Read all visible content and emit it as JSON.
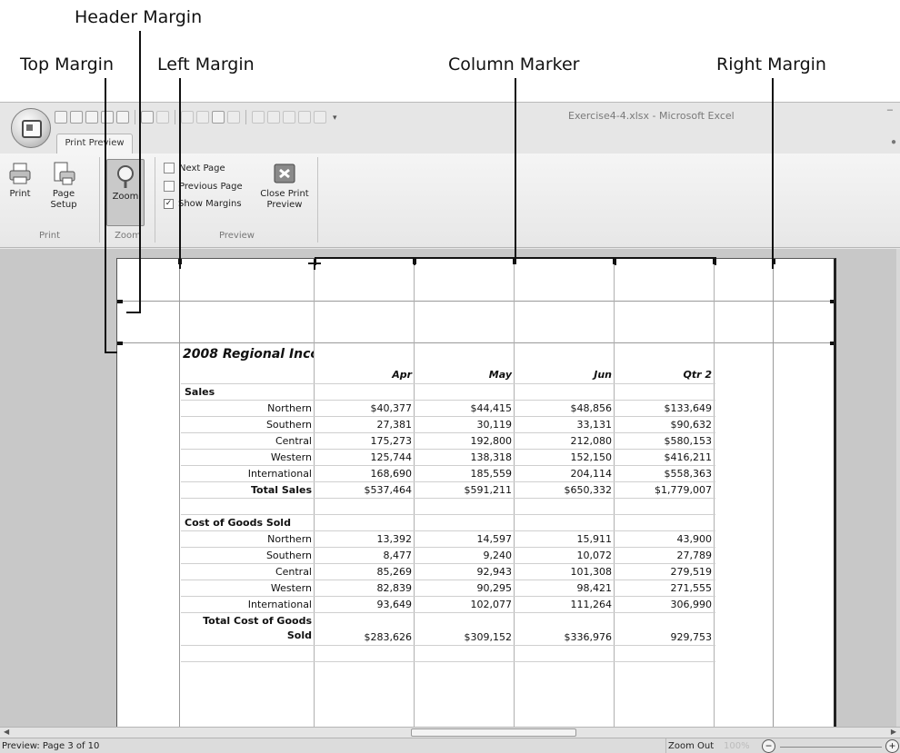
{
  "callouts": {
    "header_margin": "Header Margin",
    "top_margin": "Top Margin",
    "left_margin": "Left Margin",
    "column_marker": "Column Marker",
    "right_margin": "Right Margin"
  },
  "window": {
    "title": "Exercise4-4.xlsx - Microsoft Excel"
  },
  "ribbon": {
    "tab": "Print Preview",
    "groups": {
      "print": {
        "label": "Print",
        "print_button": "Print",
        "page_setup_line1": "Page",
        "page_setup_line2": "Setup"
      },
      "zoom": {
        "label": "Zoom",
        "zoom_button": "Zoom"
      },
      "preview": {
        "label": "Preview",
        "next_page": "Next Page",
        "previous_page": "Previous Page",
        "show_margins": "Show Margins",
        "show_margins_checked": true,
        "close_line1": "Close Print",
        "close_line2": "Preview"
      }
    }
  },
  "sheet": {
    "title": "2008 Regional Inco",
    "headers": [
      "",
      "Apr",
      "May",
      "Jun",
      "Qtr 2"
    ],
    "sales": {
      "label": "Sales",
      "rows": [
        [
          "Northern",
          "$40,377",
          "$44,415",
          "$48,856",
          "$133,649"
        ],
        [
          "Southern",
          "27,381",
          "30,119",
          "33,131",
          "$90,632"
        ],
        [
          "Central",
          "175,273",
          "192,800",
          "212,080",
          "$580,153"
        ],
        [
          "Western",
          "125,744",
          "138,318",
          "152,150",
          "$416,211"
        ],
        [
          "International",
          "168,690",
          "185,559",
          "204,114",
          "$558,363"
        ]
      ],
      "total": [
        "Total Sales",
        "$537,464",
        "$591,211",
        "$650,332",
        "$1,779,007"
      ]
    },
    "cogs": {
      "label": "Cost of Goods Sold",
      "rows": [
        [
          "Northern",
          "13,392",
          "14,597",
          "15,911",
          "43,900"
        ],
        [
          "Southern",
          "8,477",
          "9,240",
          "10,072",
          "27,789"
        ],
        [
          "Central",
          "85,269",
          "92,943",
          "101,308",
          "279,519"
        ],
        [
          "Western",
          "82,839",
          "90,295",
          "98,421",
          "271,555"
        ],
        [
          "International",
          "93,649",
          "102,077",
          "111,264",
          "306,990"
        ]
      ],
      "total_line1": "Total Cost of Goods",
      "total_line2": "Sold",
      "total_values": [
        "$283,626",
        "$309,152",
        "$336,976",
        "929,753"
      ]
    }
  },
  "status": {
    "page": "Preview: Page 3 of 10",
    "zoom_out": "Zoom Out",
    "zoom_level": "100%"
  }
}
